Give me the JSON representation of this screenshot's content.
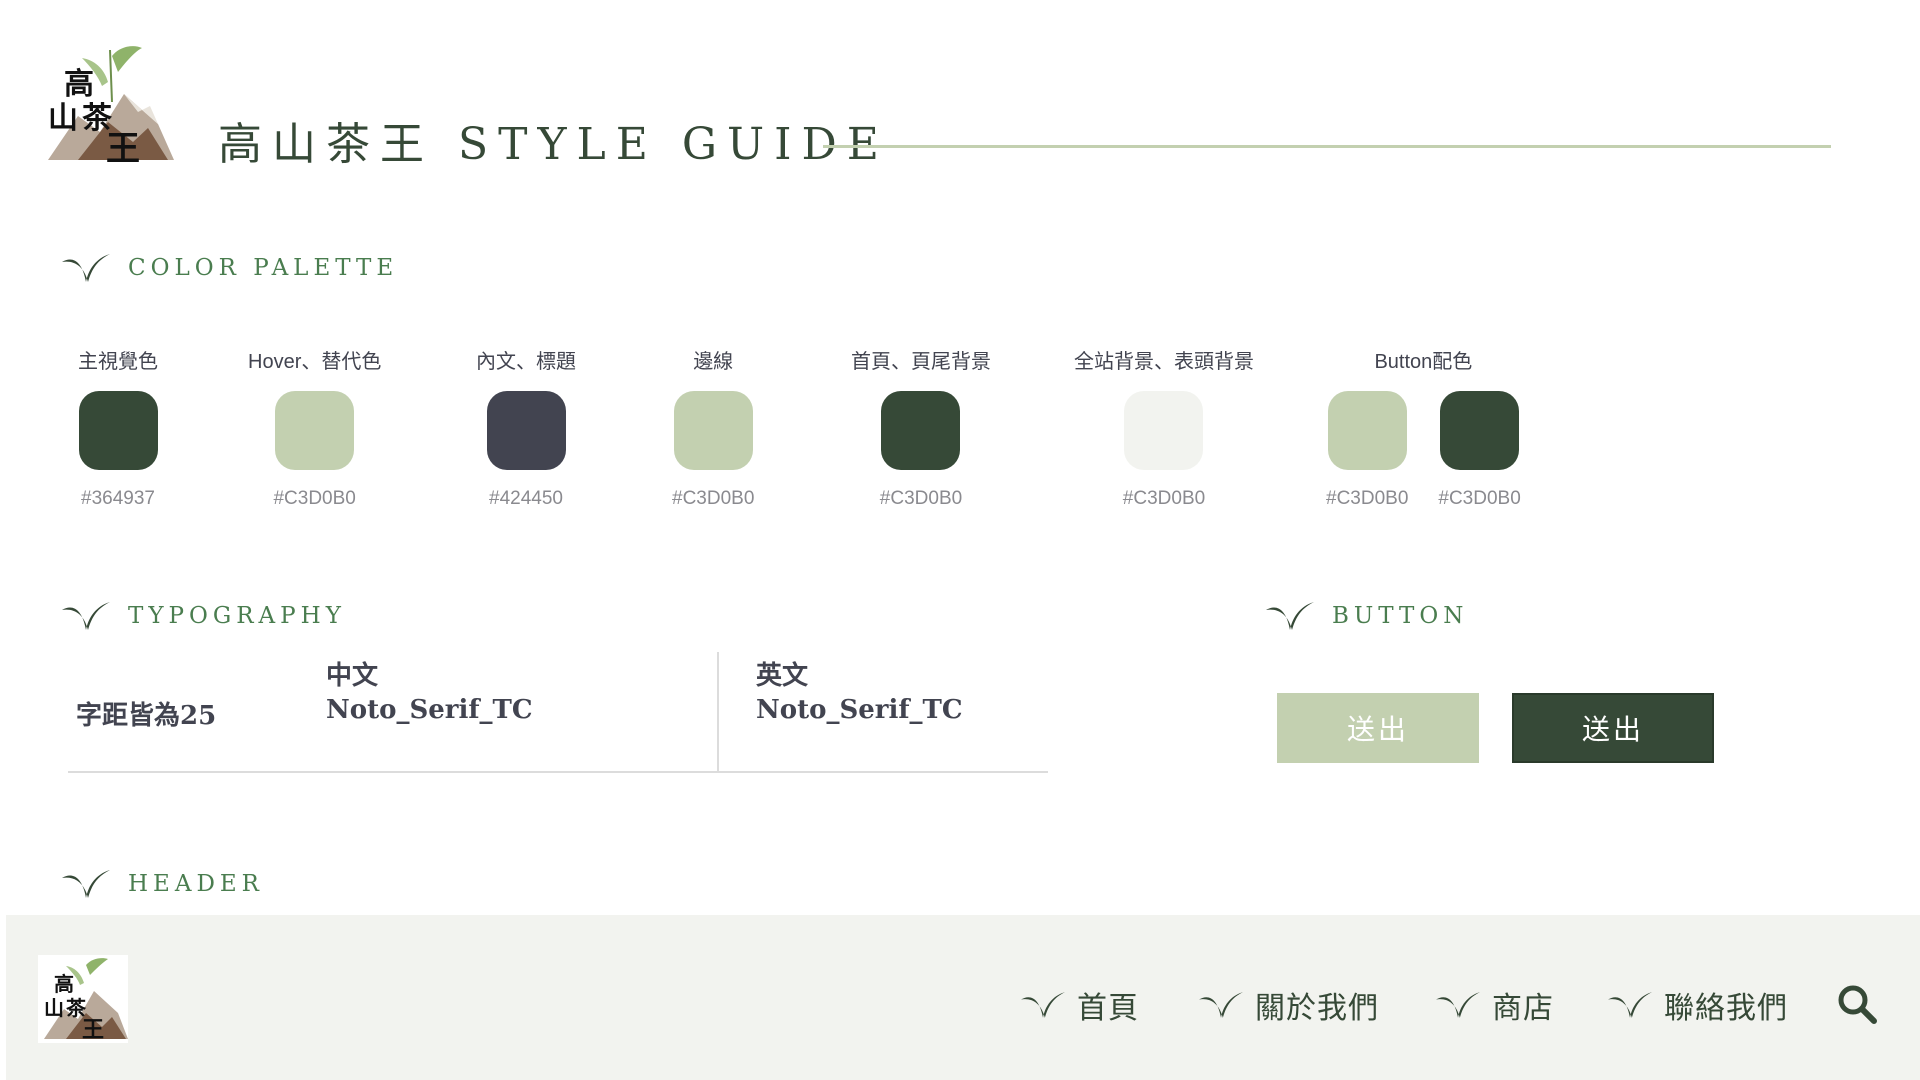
{
  "page": {
    "title": "高山茶王 STYLE GUIDE",
    "logo_text": "高山茶王"
  },
  "sections": {
    "color_palette": "COLOR PALETTE",
    "typography": "TYPOGRAPHY",
    "button": "BUTTON",
    "header": "HEADER"
  },
  "palette": [
    {
      "label": "主視覺色",
      "swatches": [
        {
          "color": "#364937",
          "hex": "#364937"
        }
      ]
    },
    {
      "label": "Hover、替代色",
      "swatches": [
        {
          "color": "#C3D0B0",
          "hex": "#C3D0B0"
        }
      ]
    },
    {
      "label": "內文、標題",
      "swatches": [
        {
          "color": "#424450",
          "hex": "#424450"
        }
      ]
    },
    {
      "label": "邊線",
      "swatches": [
        {
          "color": "#C3D0B0",
          "hex": "#C3D0B0"
        }
      ]
    },
    {
      "label": "首頁、頁尾背景",
      "swatches": [
        {
          "color": "#364937",
          "hex": "#C3D0B0"
        }
      ]
    },
    {
      "label": "全站背景、表頭背景",
      "swatches": [
        {
          "color": "#F2F3EF",
          "hex": "#C3D0B0"
        }
      ]
    },
    {
      "label": "Button配色",
      "swatches": [
        {
          "color": "#C3D0B0",
          "hex": "#C3D0B0"
        },
        {
          "color": "#364937",
          "hex": "#C3D0B0"
        }
      ]
    }
  ],
  "typography": {
    "spacing_note": "字距皆為25",
    "chinese_label": "中文",
    "chinese_font": "Noto_Serif_TC",
    "english_label": "英文",
    "english_font": "Noto_Serif_TC"
  },
  "buttons": {
    "light_label": "送出",
    "dark_label": "送出"
  },
  "header_nav": {
    "items": [
      "首頁",
      "關於我們",
      "商店",
      "聯絡我們"
    ],
    "search_icon": "search-icon"
  },
  "colors": {
    "primary": "#364937",
    "accent": "#C3D0B0",
    "text": "#424450",
    "background": "#F2F3EF"
  }
}
